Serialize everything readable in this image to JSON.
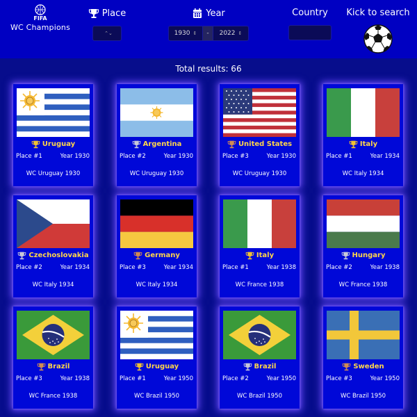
{
  "brand": {
    "logo_text": "FIFA",
    "title": "WC Champions"
  },
  "filters": {
    "place_label": "Place",
    "place_value": "",
    "year_label": "Year",
    "year_from": "1930",
    "year_separator": "-",
    "year_to": "2022",
    "country_label": "Country",
    "country_value": "",
    "kick_label": "Kick to search"
  },
  "results": {
    "total_text": "Total results: 66",
    "count": 66
  },
  "colors": {
    "gold": "#f2c230",
    "silver": "#c8c8d8",
    "bronze": "#d08a52",
    "country_text": "#ffd54a"
  },
  "cards": [
    {
      "country": "Uruguay",
      "flag": "uruguay-flag",
      "cup": "gold",
      "place": "Place #1",
      "year": "Year 1930",
      "wc": "WC Uruguay 1930"
    },
    {
      "country": "Argentina",
      "flag": "argentina-flag",
      "cup": "silver",
      "place": "Place #2",
      "year": "Year 1930",
      "wc": "WC Uruguay 1930"
    },
    {
      "country": "United States",
      "flag": "usa-flag",
      "cup": "bronze",
      "place": "Place #3",
      "year": "Year 1930",
      "wc": "WC Uruguay 1930"
    },
    {
      "country": "Italy",
      "flag": "italy-flag",
      "cup": "gold",
      "place": "Place #1",
      "year": "Year 1934",
      "wc": "WC Italy 1934"
    },
    {
      "country": "Czechoslovakia",
      "flag": "czechoslovakia-flag",
      "cup": "silver",
      "place": "Place #2",
      "year": "Year 1934",
      "wc": "WC Italy 1934"
    },
    {
      "country": "Germany",
      "flag": "germany-flag",
      "cup": "bronze",
      "place": "Place #3",
      "year": "Year 1934",
      "wc": "WC Italy 1934"
    },
    {
      "country": "Italy",
      "flag": "italy-flag",
      "cup": "gold",
      "place": "Place #1",
      "year": "Year 1938",
      "wc": "WC France 1938"
    },
    {
      "country": "Hungary",
      "flag": "hungary-flag",
      "cup": "silver",
      "place": "Place #2",
      "year": "Year 1938",
      "wc": "WC France 1938"
    },
    {
      "country": "Brazil",
      "flag": "brazil-flag",
      "cup": "bronze",
      "place": "Place #3",
      "year": "Year 1938",
      "wc": "WC France 1938"
    },
    {
      "country": "Uruguay",
      "flag": "uruguay-flag",
      "cup": "gold",
      "place": "Place #1",
      "year": "Year 1950",
      "wc": "WC Brazil 1950"
    },
    {
      "country": "Brazil",
      "flag": "brazil-flag",
      "cup": "silver",
      "place": "Place #2",
      "year": "Year 1950",
      "wc": "WC Brazil 1950"
    },
    {
      "country": "Sweden",
      "flag": "sweden-flag",
      "cup": "bronze",
      "place": "Place #3",
      "year": "Year 1950",
      "wc": "WC Brazil 1950"
    }
  ]
}
